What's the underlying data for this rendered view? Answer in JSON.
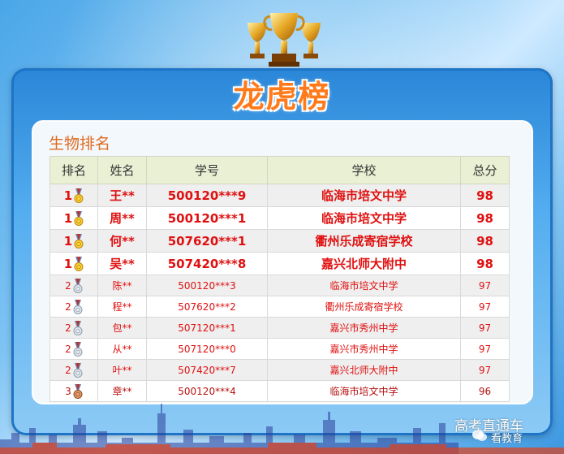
{
  "banner": {
    "title": "龙虎榜"
  },
  "section": {
    "title": "生物排名"
  },
  "table": {
    "headers": [
      "排名",
      "姓名",
      "学号",
      "学校",
      "总分"
    ],
    "rows": [
      {
        "rank": "1",
        "medal": "gold",
        "name": "王**",
        "id": "500120***9",
        "school": "临海市培文中学",
        "score": "98"
      },
      {
        "rank": "1",
        "medal": "gold",
        "name": "周**",
        "id": "500120***1",
        "school": "临海市培文中学",
        "score": "98"
      },
      {
        "rank": "1",
        "medal": "gold",
        "name": "何**",
        "id": "507620***1",
        "school": "衢州乐成寄宿学校",
        "score": "98"
      },
      {
        "rank": "1",
        "medal": "gold",
        "name": "吴**",
        "id": "507420***8",
        "school": "嘉兴北师大附中",
        "score": "98"
      },
      {
        "rank": "2",
        "medal": "silver",
        "name": "陈**",
        "id": "500120***3",
        "school": "临海市培文中学",
        "score": "97"
      },
      {
        "rank": "2",
        "medal": "silver",
        "name": "程**",
        "id": "507620***2",
        "school": "衢州乐成寄宿学校",
        "score": "97"
      },
      {
        "rank": "2",
        "medal": "silver",
        "name": "包**",
        "id": "507120***1",
        "school": "嘉兴市秀州中学",
        "score": "97"
      },
      {
        "rank": "2",
        "medal": "silver",
        "name": "从**",
        "id": "507120***0",
        "school": "嘉兴市秀州中学",
        "score": "97"
      },
      {
        "rank": "2",
        "medal": "silver",
        "name": "叶**",
        "id": "507420***7",
        "school": "嘉兴北师大附中",
        "score": "97"
      },
      {
        "rank": "3",
        "medal": "bronze",
        "name": "章**",
        "id": "500120***4",
        "school": "临海市培文中学",
        "score": "96"
      }
    ]
  },
  "watermark": {
    "line1": "高考直通车",
    "line2": "看教育"
  },
  "colors": {
    "accent": "#e01010",
    "title": "#ff7a1a",
    "section": "#e06a1f",
    "header_bg": "#eaf0d4"
  }
}
